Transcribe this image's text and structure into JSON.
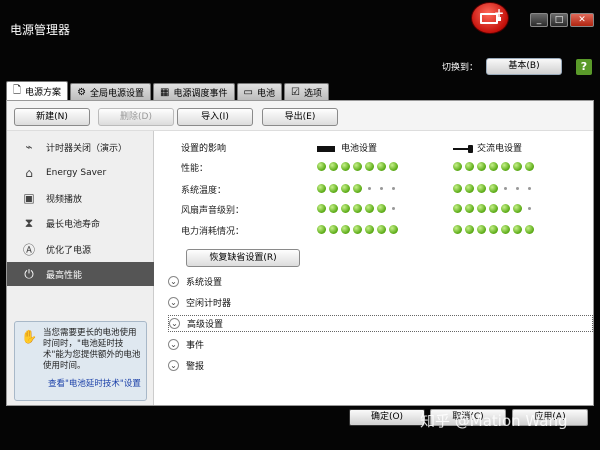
{
  "window": {
    "title": "电源管理器"
  },
  "header": {
    "switch_label": "切换到：",
    "switch_value": "基本(B)"
  },
  "tabs": [
    {
      "label": "电源方案",
      "icon": "document-icon"
    },
    {
      "label": "全局电源设置",
      "icon": "gear-icon"
    },
    {
      "label": "电源调度事件",
      "icon": "calendar-icon"
    },
    {
      "label": "电池",
      "icon": "battery-icon"
    },
    {
      "label": "选项",
      "icon": "checkbox-icon"
    }
  ],
  "toolbar": {
    "new_label": "新建(N)",
    "delete_label": "删除(D)",
    "import_label": "导入(I)",
    "export_label": "导出(E)"
  },
  "sidebar": {
    "items": [
      {
        "label": "计时器关闭（演示）",
        "icon": "timer-off-icon"
      },
      {
        "label": "Energy Saver",
        "icon": "house-icon"
      },
      {
        "label": "视频播放",
        "icon": "film-icon"
      },
      {
        "label": "最长电池寿命",
        "icon": "hourglass-battery-icon"
      },
      {
        "label": "优化了电源",
        "icon": "optimized-icon"
      },
      {
        "label": "最高性能",
        "icon": "power-icon"
      }
    ],
    "tip": {
      "text": "当您需要更长的电池使用时间时，\"电池延时技术\"能为您提供额外的电池使用时间。",
      "link": "查看\"电池延时技术\"设置"
    }
  },
  "main": {
    "impact_label": "设置的影响",
    "battery_label": "电池设置",
    "ac_label": "交流电设置",
    "rows": [
      {
        "label": "性能：",
        "battery": 7,
        "ac": 7
      },
      {
        "label": "系统温度：",
        "battery": 4,
        "ac": 4
      },
      {
        "label": "风扇声音级别：",
        "battery": 6,
        "ac": 6
      },
      {
        "label": "电力消耗情况：",
        "battery": 7,
        "ac": 7
      }
    ],
    "max_dots": 7,
    "restore_label": "恢复缺省设置(R)",
    "sections": [
      "系统设置",
      "空闲计时器",
      "高级设置",
      "事件",
      "警报"
    ]
  },
  "footer": {
    "ok_label": "确定(O)",
    "cancel_label": "取消(C)",
    "apply_label": "应用(A)"
  },
  "watermark": "知乎 @Mation Wang",
  "colors": {
    "dot_on": "#5fae1a",
    "active_item": "#555555",
    "window_bg": "#050505"
  }
}
